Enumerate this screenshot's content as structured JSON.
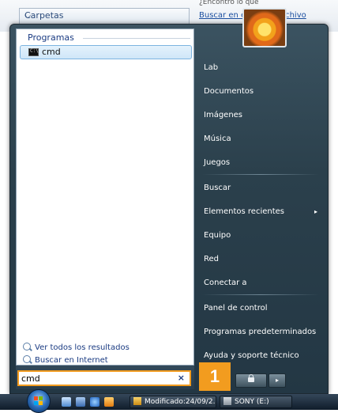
{
  "background_window": {
    "folders_label": "Carpetas",
    "hint_text": "¿Encontró lo que",
    "search_link": "Buscar en el c…del archivo"
  },
  "programs": {
    "header": "Programas",
    "items": [
      {
        "label": "cmd",
        "icon": "command-prompt-icon"
      }
    ]
  },
  "links": {
    "see_all": "Ver todos los resultados",
    "search_internet": "Buscar en Internet"
  },
  "search": {
    "value": "cmd",
    "clear_label": "×"
  },
  "right_column": {
    "items": [
      "Lab",
      "Documentos",
      "Imágenes",
      "Música",
      "Juegos",
      "Buscar",
      "Elementos recientes",
      "Equipo",
      "Red",
      "Conectar a",
      "Panel de control",
      "Programas predeterminados",
      "Ayuda y soporte técnico"
    ],
    "submenu_arrow": "▸"
  },
  "power": {
    "arrow_label": "▸"
  },
  "step_badge": "1",
  "taskbar": {
    "tasks": [
      "Modificado:24/09/2...",
      "SONY (E:)"
    ]
  },
  "colors": {
    "highlight_orange": "#f29c1f",
    "link_blue": "#1a3b82"
  }
}
